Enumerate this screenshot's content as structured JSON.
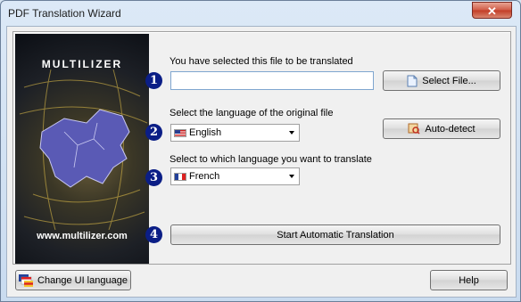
{
  "window": {
    "title": "PDF Translation Wizard",
    "close_label": "✕"
  },
  "banner": {
    "brand": "MULTILIZER",
    "url": "www.multilizer.com"
  },
  "steps": [
    {
      "number": "1",
      "label": "You have selected this file to be translated"
    },
    {
      "number": "2",
      "label": "Select the language of the original file"
    },
    {
      "number": "3",
      "label": "Select to which language you want to translate"
    },
    {
      "number": "4"
    }
  ],
  "file_input": {
    "value": "",
    "placeholder": ""
  },
  "buttons": {
    "select_file": "Select File...",
    "auto_detect": "Auto-detect",
    "start": "Start Automatic Translation",
    "change_ui_language": "Change UI language",
    "help": "Help"
  },
  "source_language": {
    "selected": "English",
    "flag_icon": "us-flag-icon"
  },
  "target_language": {
    "selected": "French",
    "flag_icon": "france-flag-icon"
  },
  "colors": {
    "step_badge": "#0b1e86",
    "close_button": "#c23b25"
  }
}
